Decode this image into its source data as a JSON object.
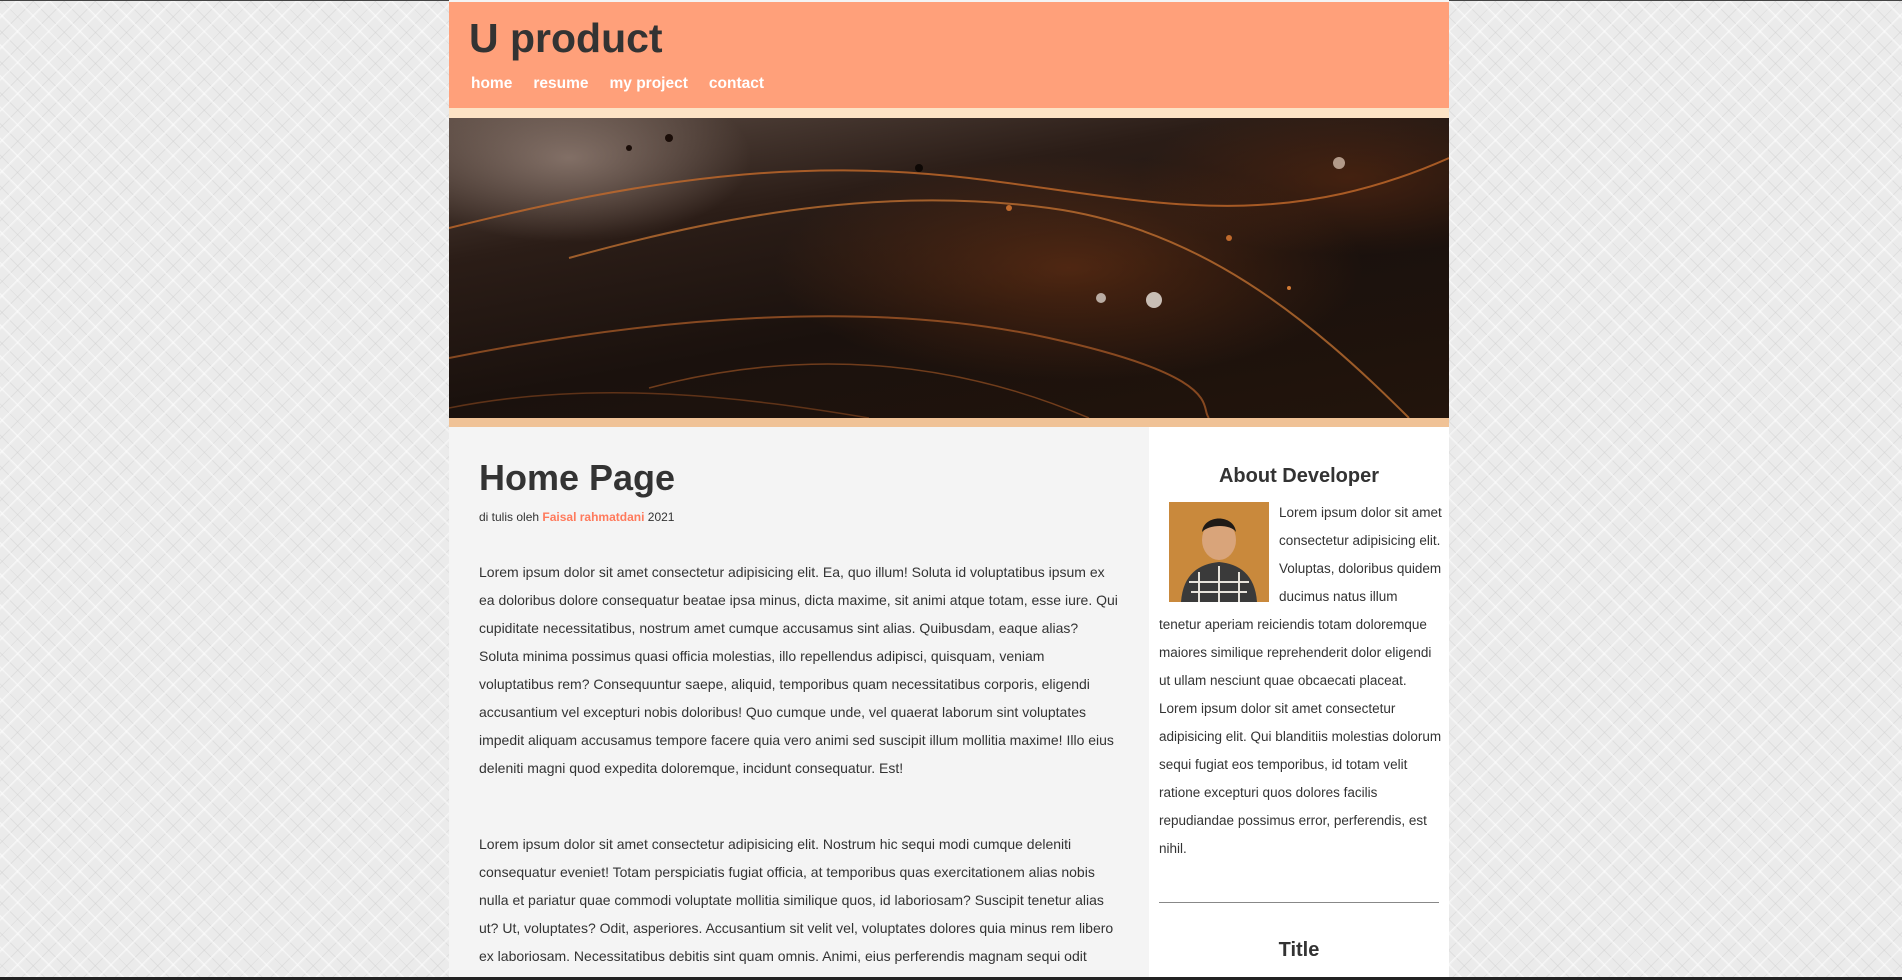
{
  "site": {
    "title": "U product"
  },
  "nav": {
    "items": [
      "home",
      "resume",
      "my project",
      "contact"
    ]
  },
  "article": {
    "title": "Home Page",
    "meta_prefix": "di tulis oleh",
    "author": "Faisal rahmatdani",
    "year": "2021",
    "paragraphs": [
      "Lorem ipsum dolor sit amet consectetur adipisicing elit. Ea, quo illum! Soluta id voluptatibus ipsum ex ea doloribus dolore consequatur beatae ipsa minus, dicta maxime, sit animi atque totam, esse iure. Qui cupiditate necessitatibus, nostrum amet cumque accusamus sint alias. Quibusdam, eaque alias? Soluta minima possimus quasi officia molestias, illo repellendus adipisci, quisquam, veniam voluptatibus rem? Consequuntur saepe, aliquid, temporibus quam necessitatibus corporis, eligendi accusantium vel excepturi nobis doloribus! Quo cumque unde, vel quaerat laborum sint voluptates impedit aliquam accusamus tempore facere quia vero animi sed suscipit illum mollitia maxime! Illo eius deleniti magni quod expedita doloremque, incidunt consequatur. Est!",
      "Lorem ipsum dolor sit amet consectetur adipisicing elit. Nostrum hic sequi modi cumque deleniti consequatur eveniet! Totam perspiciatis fugiat officia, at temporibus quas exercitationem alias nobis nulla et pariatur quae commodi voluptate mollitia similique quos, id laboriosam? Suscipit tenetur alias ut? Ut, voluptates? Odit, asperiores. Accusantium sit velit vel, voluptates dolores quia minus rem libero ex laboriosam. Necessitatibus debitis sint quam omnis. Animi, eius perferendis magnam sequi odit"
    ]
  },
  "sidebar": {
    "about_title": "About Developer",
    "about_text": "Lorem ipsum dolor sit amet consectetur adipisicing elit. Voluptas, doloribus quidem ducimus natus illum tenetur aperiam reiciendis totam doloremque maiores similique reprehenderit dolor eligendi ut ullam nesciunt quae obcaecati placeat. Lorem ipsum dolor sit amet consectetur adipisicing elit. Qui blanditiis molestias dolorum sequi fugiat eos temporibus, id totam velit ratione excepturi quos dolores facilis repudiandae possimus error, perferendis, est nihil.",
    "second_title": "Title"
  },
  "colors": {
    "header": "#ffa07a",
    "accent_author": "#ff7a5c",
    "text": "#333333"
  }
}
